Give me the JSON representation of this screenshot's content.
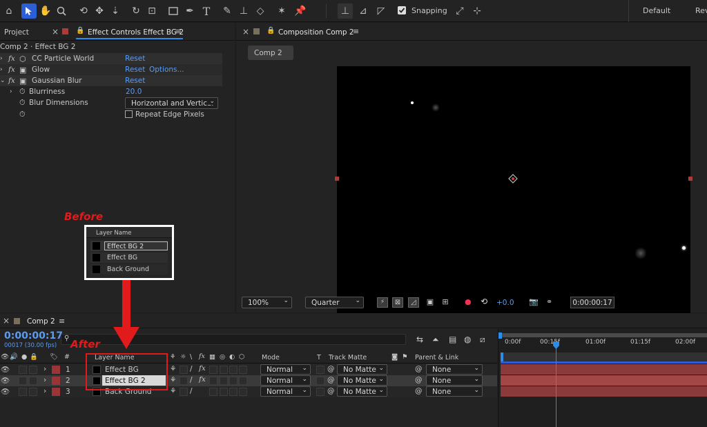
{
  "toolbar": {
    "snapping_label": "Snapping",
    "workspace_default": "Default",
    "workspace_review": "Rev"
  },
  "left_panel": {
    "project_tab": "Project",
    "effect_controls_tab": "Effect Controls Effect BG 2",
    "breadcrumb": "Comp 2 · Effect BG 2",
    "effects": [
      {
        "name": "CC Particle World",
        "reset": "Reset",
        "extra": ""
      },
      {
        "name": "Glow",
        "reset": "Reset",
        "extra": "Options..."
      },
      {
        "name": "Gaussian Blur",
        "reset": "Reset",
        "extra": ""
      }
    ],
    "blurriness_label": "Blurriness",
    "blurriness_value": "20.0",
    "blur_dimensions_label": "Blur Dimensions",
    "blur_dimensions_value": "Horizontal and Vertical",
    "repeat_edge_label": "Repeat Edge Pixels"
  },
  "before_box": {
    "label": "Before",
    "header": "Layer Name",
    "layers": [
      "Effect BG 2",
      "Effect BG",
      "Back Ground"
    ]
  },
  "after_label": "After",
  "composition": {
    "tab": "Composition Comp 2",
    "sub_tab": "Comp 2",
    "zoom": "100%",
    "resolution": "Quarter",
    "exposure": "+0.0",
    "timecode": "0:00:00:17"
  },
  "timeline": {
    "tab": "Comp 2",
    "current_time": "0:00:00:17",
    "frame_info": "00017 (30.00 fps)",
    "ruler": [
      "0:00f",
      "00:15f",
      "01:00f",
      "01:15f",
      "02:00f"
    ],
    "columns": {
      "layer_name": "Layer Name",
      "mode": "Mode",
      "t": "T",
      "track_matte": "Track Matte",
      "parent": "Parent & Link"
    },
    "layers": [
      {
        "num": "1",
        "name": "Effect BG",
        "mode": "Normal",
        "matte": "No Matte",
        "parent": "None"
      },
      {
        "num": "2",
        "name": "Effect BG 2",
        "mode": "Normal",
        "matte": "No Matte",
        "parent": "None"
      },
      {
        "num": "3",
        "name": "Back Ground",
        "mode": "Normal",
        "matte": "No Matte",
        "parent": "None"
      }
    ]
  }
}
